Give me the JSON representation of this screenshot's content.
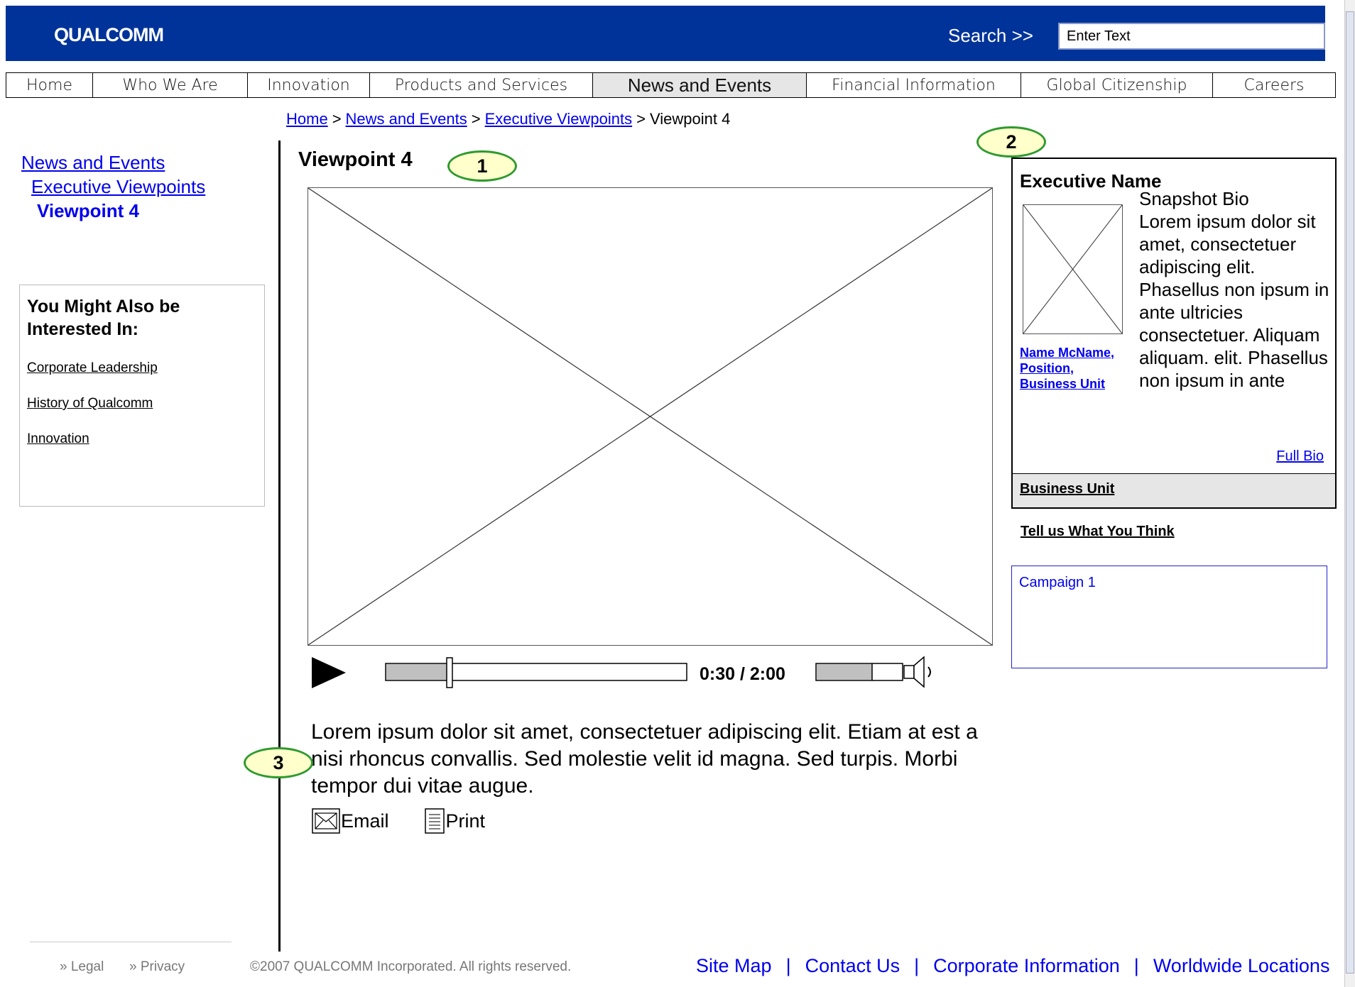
{
  "header": {
    "logo": "QUALCOMM",
    "search_label": "Search  >>",
    "search_value": "Enter Text"
  },
  "nav": {
    "items": [
      "Home",
      "Who We Are",
      "Innovation",
      "Products and Services",
      "News and Events",
      "Financial Information",
      "Global Citizenship",
      "Careers"
    ],
    "active": "News and Events"
  },
  "breadcrumb": {
    "items": [
      "Home",
      "News and Events",
      "Executive Viewpoints"
    ],
    "current": "Viewpoint 4",
    "separator": ">"
  },
  "left_nav": {
    "level1": "News and Events",
    "level2": "Executive Viewpoints",
    "level3": "Viewpoint 4"
  },
  "related": {
    "title": "You Might Also be Interested In:",
    "links": [
      "Corporate Leadership",
      "History of Qualcomm",
      "Innovation"
    ]
  },
  "main": {
    "title": "Viewpoint 4",
    "player": {
      "time": "0:30 / 2:00",
      "progress": 0.21,
      "volume": 0.65
    },
    "body": "Lorem ipsum dolor sit amet, consectetuer adipiscing elit. Etiam at est a nisi rhoncus convallis. Sed molestie velit id magna. Sed turpis. Morbi tempor dui vitae augue.",
    "email_label": "Email",
    "print_label": "Print"
  },
  "markers": [
    "1",
    "2",
    "3"
  ],
  "executive": {
    "name": "Executive Name",
    "caption": [
      "Name McName,",
      "Position,",
      "Business Unit"
    ],
    "bio_title": "Snapshot Bio",
    "bio": "Lorem ipsum dolor sit amet, consectetuer adipiscing elit. Phasellus non ipsum in ante ultricies consectetuer. Aliquam aliquam. elit. Phasellus non ipsum in ante",
    "full_bio": "Full Bio",
    "business_unit": "Business Unit"
  },
  "tell_us": "Tell us What You Think",
  "campaign": "Campaign 1",
  "footer": {
    "legal": "» Legal",
    "privacy": "» Privacy",
    "copyright": "©2007 QUALCOMM Incorporated. All rights reserved.",
    "links": [
      "Site Map",
      "Contact Us",
      "Corporate Information",
      "Worldwide Locations"
    ]
  },
  "colors": {
    "header_bg": "#003399",
    "link": "#0000ee",
    "marker_border": "#2f9a2f",
    "marker_fill": "#ffffcc"
  }
}
